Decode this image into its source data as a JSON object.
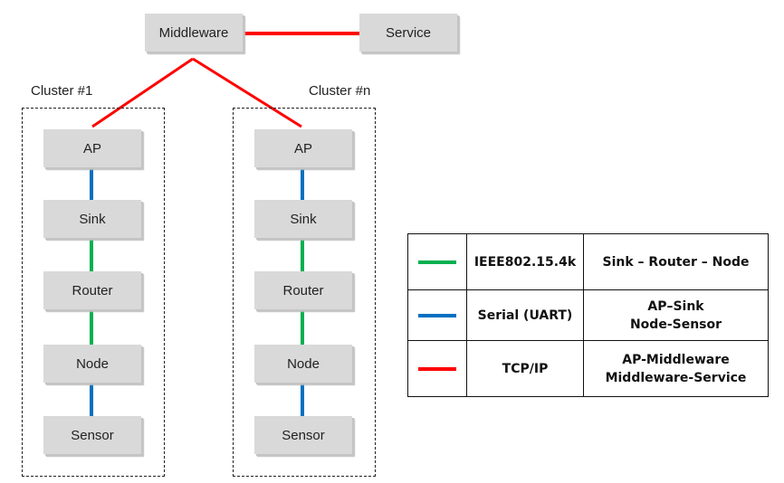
{
  "colors": {
    "ieee": "#00b050",
    "serial": "#0070c0",
    "tcpip": "#ff0000",
    "node_fill": "#d9d9d9"
  },
  "nodes": {
    "middleware": "Middleware",
    "service": "Service"
  },
  "clusters": [
    {
      "label": "Cluster #1",
      "nodes": [
        "AP",
        "Sink",
        "Router",
        "Node",
        "Sensor"
      ]
    },
    {
      "label": "Cluster #n",
      "nodes": [
        "AP",
        "Sink",
        "Router",
        "Node",
        "Sensor"
      ]
    }
  ],
  "edges": [
    {
      "from": "Middleware",
      "to": "Service",
      "type": "tcpip"
    },
    {
      "from": "Middleware",
      "to": "AP (Cluster #1)",
      "type": "tcpip"
    },
    {
      "from": "Middleware",
      "to": "AP (Cluster #n)",
      "type": "tcpip"
    },
    {
      "from": "AP",
      "to": "Sink",
      "type": "serial"
    },
    {
      "from": "Sink",
      "to": "Router",
      "type": "ieee"
    },
    {
      "from": "Router",
      "to": "Node",
      "type": "ieee"
    },
    {
      "from": "Node",
      "to": "Sensor",
      "type": "serial"
    }
  ],
  "legend": [
    {
      "type": "ieee",
      "protocol": "IEEE802.15.4k",
      "links": [
        "Sink – Router – Node"
      ]
    },
    {
      "type": "serial",
      "protocol": "Serial (UART)",
      "links": [
        "AP–Sink",
        "Node-Sensor"
      ]
    },
    {
      "type": "tcpip",
      "protocol": "TCP/IP",
      "links": [
        "AP-Middleware",
        "Middleware-Service"
      ]
    }
  ]
}
